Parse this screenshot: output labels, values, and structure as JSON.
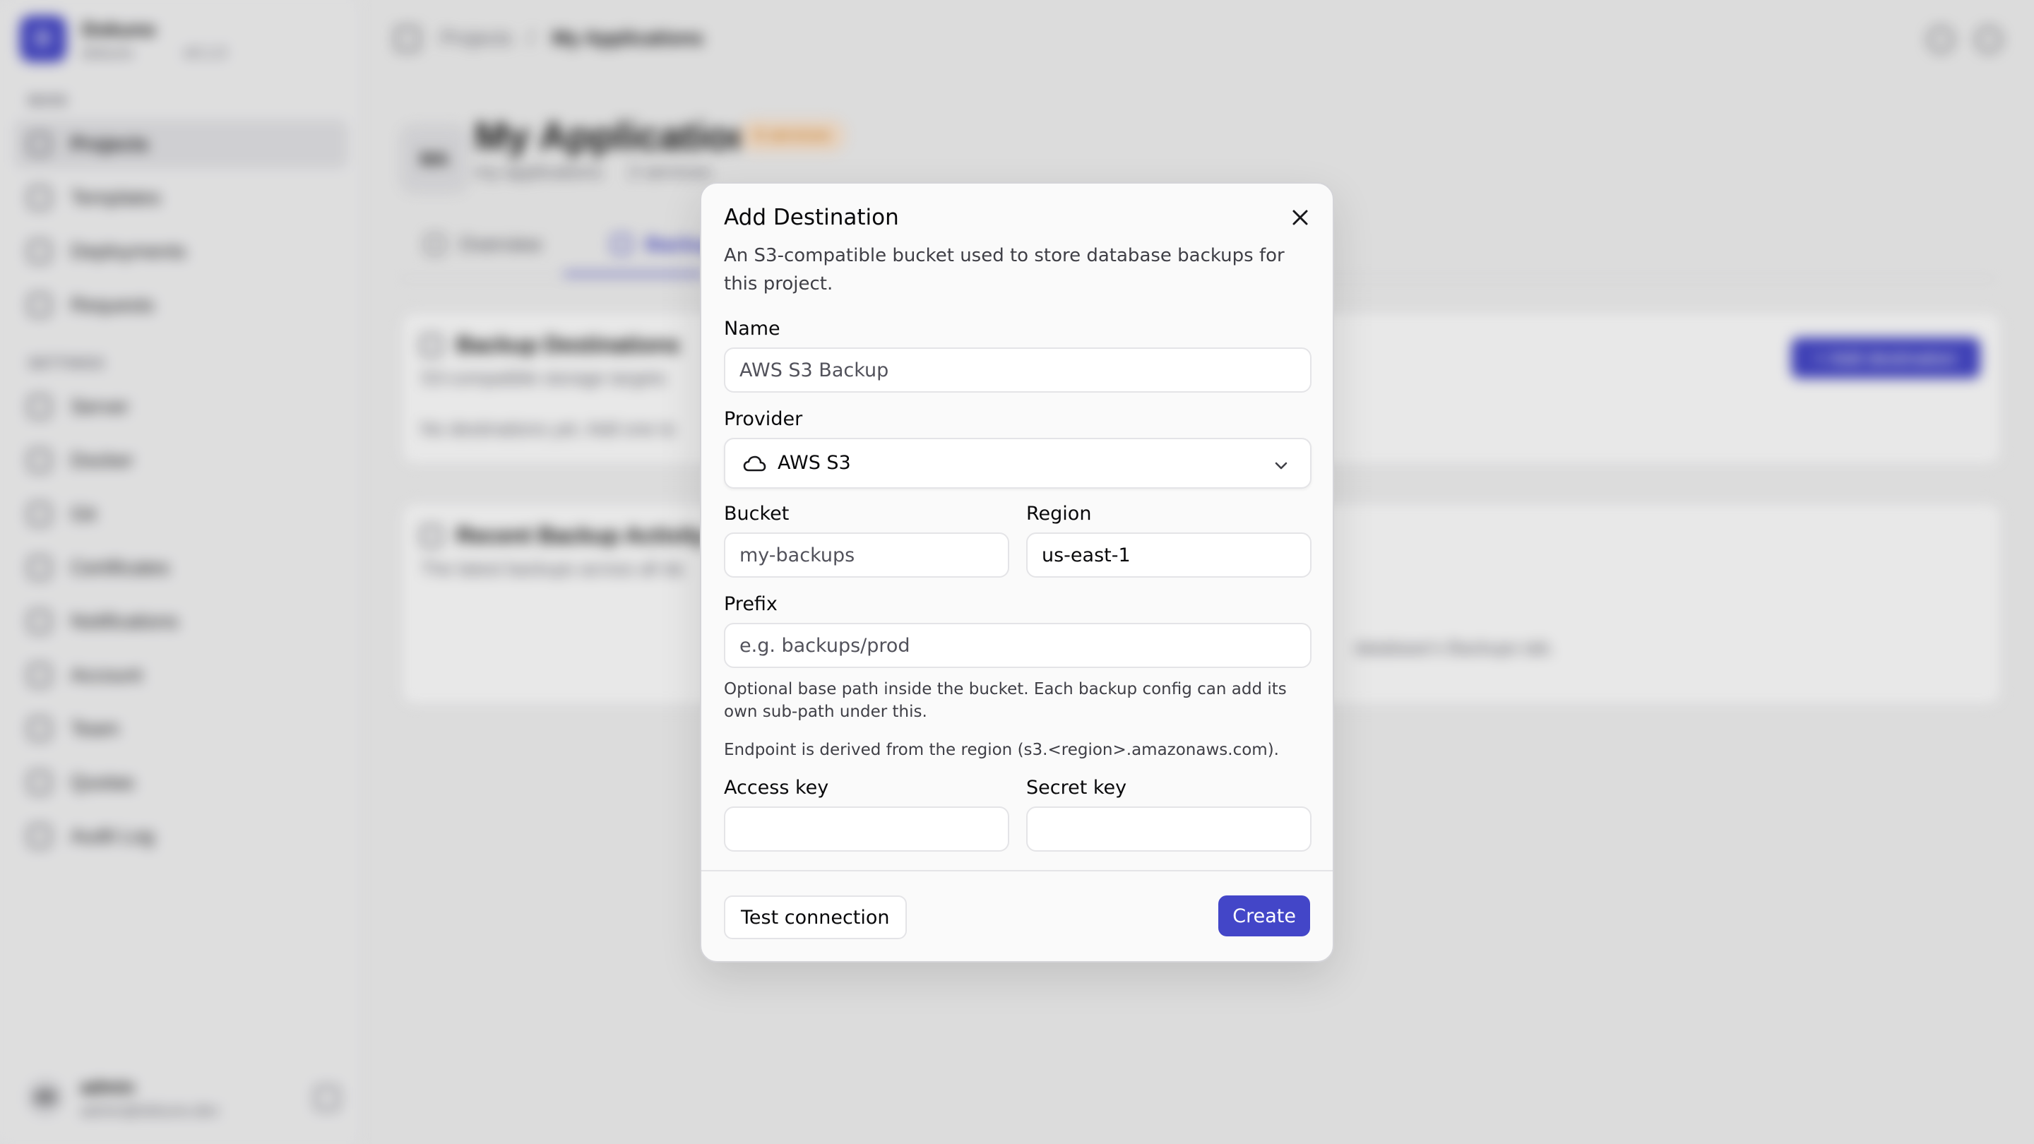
{
  "app": {
    "brand": {
      "logo_text": "D",
      "name": "Dokuno",
      "subtitle": "dokuno",
      "version": "v0.1.0"
    },
    "sidebar": {
      "section_main": "MAIN",
      "section_settings": "SETTINGS",
      "main_items": [
        {
          "label": "Projects",
          "active": true
        },
        {
          "label": "Templates"
        },
        {
          "label": "Deployments"
        },
        {
          "label": "Requests"
        }
      ],
      "settings_items": [
        {
          "label": "Server"
        },
        {
          "label": "Docker"
        },
        {
          "label": "Git"
        },
        {
          "label": "Certificates"
        },
        {
          "label": "Notifications"
        },
        {
          "label": "Account"
        },
        {
          "label": "Team"
        },
        {
          "label": "Quotas"
        },
        {
          "label": "Audit Log"
        }
      ],
      "user": {
        "initials": "AD",
        "name": "admin",
        "email": "admin@dokuno.dev"
      }
    },
    "breadcrumb": {
      "root": "Projects",
      "separator": "/",
      "current": "My Applications"
    },
    "project": {
      "icon_text": "MA",
      "title": "My Applications",
      "badge": "6 services",
      "slug": "my-applications",
      "meta": "2 services",
      "tabs": [
        {
          "label": "Overview"
        },
        {
          "label": "Backups",
          "active": true
        }
      ]
    },
    "backup_card": {
      "title": "Backup Destinations",
      "subtitle": "S3-compatible storage targets",
      "empty": "No destinations yet. Add one to",
      "button": "+ Add destination"
    },
    "activity_card": {
      "title": "Recent Backup Activity",
      "subtitle": "The latest backups across all da",
      "hint": "database's Backups tab."
    }
  },
  "dialog": {
    "title": "Add Destination",
    "close_icon": "x-close-icon",
    "description": "An S3-compatible bucket used to store database backups for this project.",
    "fields": {
      "name": {
        "label": "Name",
        "value": "AWS S3 Backup"
      },
      "provider": {
        "label": "Provider",
        "value": "AWS S3",
        "icon": "cloud-icon"
      },
      "bucket": {
        "label": "Bucket",
        "value": "my-backups"
      },
      "region": {
        "label": "Region",
        "value": "us-east-1"
      },
      "prefix": {
        "label": "Prefix",
        "placeholder": "e.g. backups/prod",
        "value": ""
      },
      "prefix_help": "Optional base path inside the bucket. Each backup config can add its own sub-path under this.",
      "endpoint_help": "Endpoint is derived from the region (s3.<region>.amazonaws.com).",
      "access_key": {
        "label": "Access key",
        "value": ""
      },
      "secret_key": {
        "label": "Secret key",
        "value": ""
      }
    },
    "buttons": {
      "test": "Test connection",
      "create": "Create"
    },
    "colors": {
      "primary": "#4346c8",
      "border": "#e4e4e7",
      "text": "#09090b"
    }
  }
}
